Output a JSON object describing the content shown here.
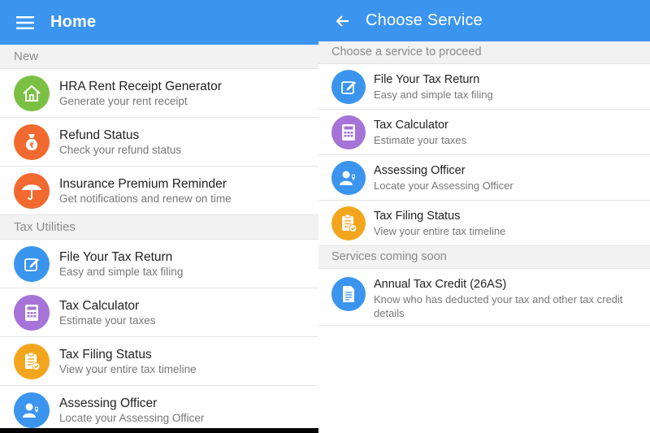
{
  "colors": {
    "appbar": "#3b95ee",
    "green": "#7bc043",
    "orange": "#f26a30",
    "blue": "#3b95ee",
    "purple": "#a673d8",
    "amber": "#f3a61d"
  },
  "home": {
    "title": "Home",
    "menu_icon": "hamburger-menu-icon",
    "sections": [
      {
        "header": "New",
        "items": [
          {
            "title": "HRA Rent Receipt Generator",
            "subtitle": "Generate your rent receipt",
            "icon": "house-icon",
            "color": "#7bc043"
          },
          {
            "title": "Refund Status",
            "subtitle": "Check your refund status",
            "icon": "money-bag-icon",
            "color": "#f26a30"
          },
          {
            "title": "Insurance Premium Reminder",
            "subtitle": "Get notifications and renew on time",
            "icon": "umbrella-icon",
            "color": "#f26a30"
          }
        ]
      },
      {
        "header": "Tax Utilities",
        "items": [
          {
            "title": "File Your Tax Return",
            "subtitle": "Easy and simple tax filing",
            "icon": "edit-icon",
            "color": "#3b95ee"
          },
          {
            "title": "Tax Calculator",
            "subtitle": "Estimate your taxes",
            "icon": "calculator-icon",
            "color": "#a673d8"
          },
          {
            "title": "Tax Filing Status",
            "subtitle": "View your entire tax timeline",
            "icon": "clipboard-check-icon",
            "color": "#f3a61d"
          },
          {
            "title": "Assessing Officer",
            "subtitle": "Locate your Assessing Officer",
            "icon": "officer-location-icon",
            "color": "#3b95ee"
          }
        ]
      }
    ]
  },
  "choose_service": {
    "title": "Choose Service",
    "back_icon": "back-arrow-icon",
    "sections": [
      {
        "header": "Choose a service to proceed",
        "items": [
          {
            "title": "File Your Tax Return",
            "subtitle": "Easy and simple tax filing",
            "icon": "edit-icon",
            "color": "#3b95ee"
          },
          {
            "title": "Tax Calculator",
            "subtitle": "Estimate your taxes",
            "icon": "calculator-icon",
            "color": "#a673d8"
          },
          {
            "title": "Assessing Officer",
            "subtitle": "Locate your Assessing Officer",
            "icon": "officer-location-icon",
            "color": "#3b95ee"
          },
          {
            "title": "Tax Filing Status",
            "subtitle": "View your entire tax timeline",
            "icon": "clipboard-check-icon",
            "color": "#f3a61d"
          }
        ]
      },
      {
        "header": "Services coming soon",
        "items": [
          {
            "title": "Annual Tax Credit (26AS)",
            "subtitle": "Know who has deducted your tax and other tax credit details",
            "icon": "document-icon",
            "color": "#3b95ee"
          }
        ]
      }
    ]
  }
}
